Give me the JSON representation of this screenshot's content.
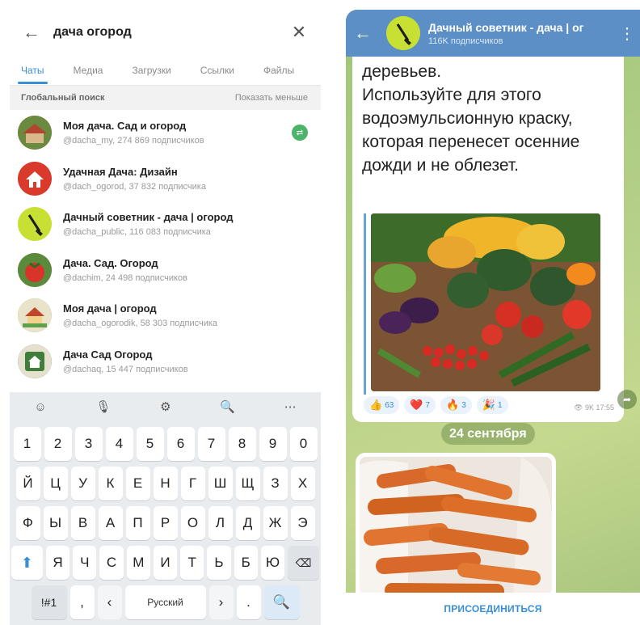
{
  "search": {
    "query": "дача огород",
    "back_icon": "arrow-left-icon",
    "clear_icon": "close-icon"
  },
  "tabs": [
    {
      "label": "Чаты",
      "active": true
    },
    {
      "label": "Медиа",
      "active": false
    },
    {
      "label": "Загрузки",
      "active": false
    },
    {
      "label": "Ссылки",
      "active": false
    },
    {
      "label": "Файлы",
      "active": false
    }
  ],
  "global_search": {
    "title": "Глобальный поиск",
    "action": "Показать меньше"
  },
  "results": [
    {
      "name": "Моя дача. Сад и огород",
      "sub": "@dacha_my, 274 869 подписчиков",
      "badge": "",
      "avatar_color": "#9b6a3a"
    },
    {
      "name": "Удачная Дача: Дизайн",
      "sub": "@dach_ogorod, 37 832 подписчика",
      "avatar_color": "#d93a2b"
    },
    {
      "name": "Дачный советник - дача | огород",
      "sub": "@dacha_public, 116 083 подписчика",
      "avatar_color": "#c8e033"
    },
    {
      "name": "Дача. Сад. Огород",
      "sub": "@dachim, 24 498 подписчиков",
      "avatar_color": "#c2443a"
    },
    {
      "name": "Моя дача | огород",
      "sub": "@dacha_ogorodik, 58 303 подписчика",
      "avatar_color": "#7fb56b"
    },
    {
      "name": "Дача Сад Огород",
      "sub": "@dachaq, 15 447 подписчиков",
      "avatar_color": "#3f7d3a"
    }
  ],
  "keyboard": {
    "tools": [
      "☺",
      "🎙",
      "⚙",
      "🔍",
      "⋯"
    ],
    "row_numbers": [
      "1",
      "2",
      "3",
      "4",
      "5",
      "6",
      "7",
      "8",
      "9",
      "0"
    ],
    "row1": [
      "Й",
      "Ц",
      "У",
      "К",
      "Е",
      "Н",
      "Г",
      "Ш",
      "Щ",
      "З",
      "Х"
    ],
    "row2": [
      "Ф",
      "Ы",
      "В",
      "А",
      "П",
      "Р",
      "О",
      "Л",
      "Д",
      "Ж",
      "Э"
    ],
    "row3": [
      "Я",
      "Ч",
      "С",
      "М",
      "И",
      "Т",
      "Ь",
      "Б",
      "Ю"
    ],
    "sym_label": "!#1",
    "comma": ",",
    "lang_prev": "‹",
    "space_label": "Русский",
    "lang_next": "›",
    "period": ".",
    "shift_icon": "shift-icon",
    "backspace_icon": "backspace-icon",
    "go_icon": "search-icon"
  },
  "channel": {
    "title": "Дачный советник - дача | ог",
    "subscribers": "116K подписчиков",
    "message_text": "деревьев.\nИспользуйте для этого водоэмульсионную краску, которая перенесет осенние дожди и не облезет.",
    "reactions": [
      {
        "emoji": "👍",
        "count": "63"
      },
      {
        "emoji": "❤️",
        "count": "7"
      },
      {
        "emoji": "🔥",
        "count": "3"
      },
      {
        "emoji": "🎉",
        "count": "1"
      }
    ],
    "views": "9K",
    "time": "17:55",
    "date_separator": "24 сентября",
    "join_label": "ПРИСОЕДИНИТЬСЯ"
  },
  "colors": {
    "accent": "#3a8ed6",
    "header": "#5b8fc6",
    "unread_badge": "#4cb36a"
  }
}
